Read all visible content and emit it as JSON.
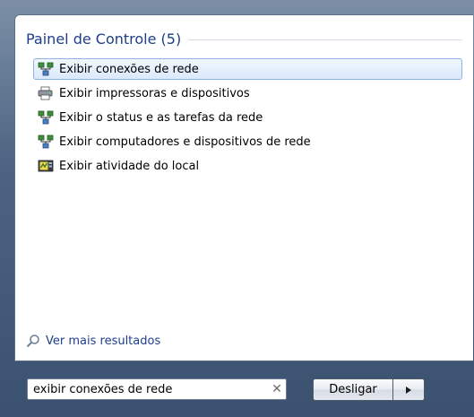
{
  "group": {
    "title": "Painel de Controle (5)"
  },
  "results": [
    {
      "label": "Exibir conexões de rede",
      "icon": "network-connections-icon",
      "selected": true
    },
    {
      "label": "Exibir impressoras e dispositivos",
      "icon": "printer-devices-icon",
      "selected": false
    },
    {
      "label": "Exibir o status e as tarefas da rede",
      "icon": "network-status-icon",
      "selected": false
    },
    {
      "label": "Exibir computadores e dispositivos de rede",
      "icon": "network-computers-icon",
      "selected": false
    },
    {
      "label": "Exibir atividade do local",
      "icon": "location-activity-icon",
      "selected": false
    }
  ],
  "see_more": {
    "label": "Ver mais resultados",
    "icon": "search-icon"
  },
  "search": {
    "value": "exibir conexões de rede",
    "clear_icon": "close-icon"
  },
  "shutdown": {
    "label": "Desligar",
    "arrow_icon": "triangle-right-icon"
  },
  "colors": {
    "accent": "#1e3e8c",
    "selection_border": "#8bb4e6",
    "frame": "#4c6482"
  }
}
